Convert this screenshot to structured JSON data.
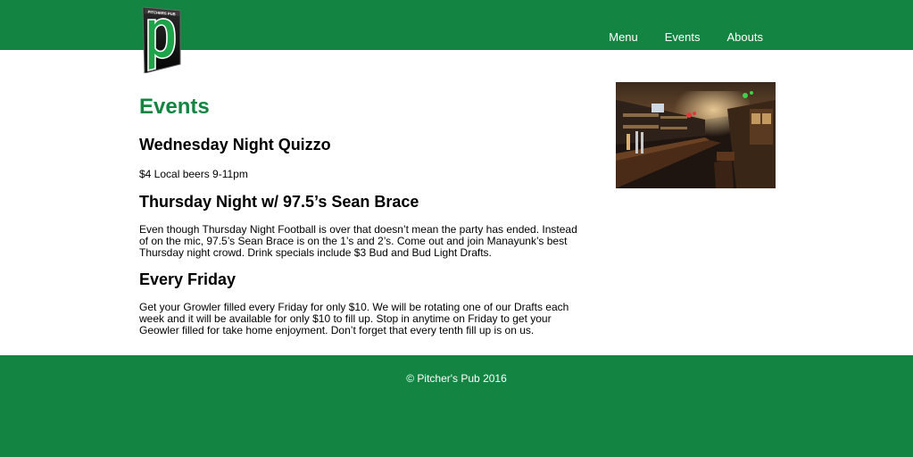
{
  "brand": {
    "logo_text": "PITCHERS PUB",
    "colors": {
      "primary": "#138441",
      "text": "#000000",
      "nav_text": "#ffffff"
    }
  },
  "nav": {
    "items": [
      {
        "label": "Menu"
      },
      {
        "label": "Events"
      },
      {
        "label": "Abouts"
      }
    ]
  },
  "main": {
    "title": "Events",
    "events": [
      {
        "title": "Wednesday Night Quizzo",
        "description": "$4 Local beers 9-11pm"
      },
      {
        "title": "Thursday Night w/ 97.5’s Sean Brace",
        "description": "Even though Thursday Night Football is over that doesn’t mean the party has ended. Instead of on the mic, 97.5’s Sean Brace is on the 1’s and 2’s. Come out and join Manayunk’s best Thursday night crowd. Drink specials include $3 Bud and Bud Light Drafts."
      },
      {
        "title": "Every Friday",
        "description": "Get your Growler filled every Friday for only $10. We will be rotating one of our Drafts each week and it will be available for only $10 to fill up. Stop in anytime on Friday to get your Geowler filled for take home enjoyment. Don’t forget that every tenth fill up is on us."
      }
    ]
  },
  "footer": {
    "text": "© Pitcher's Pub 2016"
  }
}
